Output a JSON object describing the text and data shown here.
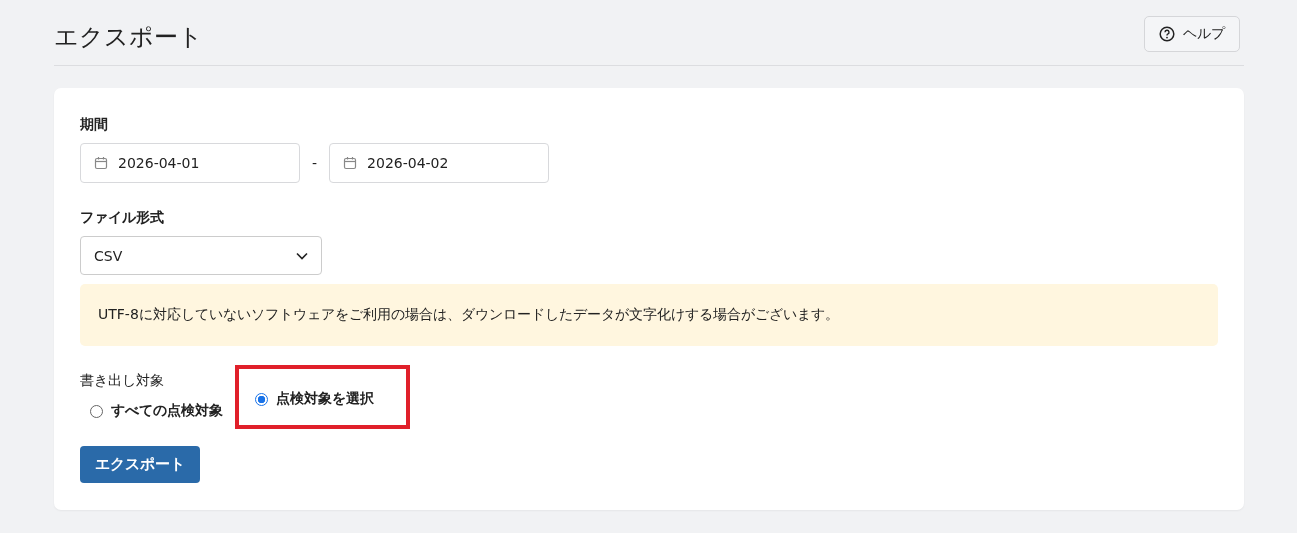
{
  "title": "エクスポート",
  "help_button": {
    "label": "ヘルプ"
  },
  "period": {
    "label": "期間",
    "start": "2026-04-01",
    "separator": "-",
    "end": "2026-04-02"
  },
  "file_format": {
    "label": "ファイル形式",
    "value": "CSV"
  },
  "notice": "UTF-8に対応していないソフトウェアをご利用の場合は、ダウンロードしたデータが文字化けする場合がございます。",
  "target": {
    "label": "書き出し対象",
    "options": [
      {
        "label": "すべての点検対象",
        "selected": false,
        "highlighted": false
      },
      {
        "label": "点検対象を選択",
        "selected": true,
        "highlighted": true
      }
    ]
  },
  "export_button": {
    "label": "エクスポート"
  }
}
